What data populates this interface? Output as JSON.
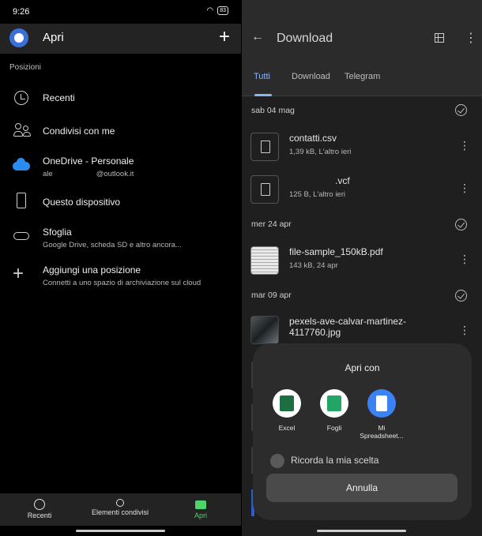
{
  "status_bar": {
    "time": "9:26",
    "battery": "83"
  },
  "left": {
    "app_title": "Apri",
    "section": "Posizioni",
    "items": [
      {
        "label": "Recenti",
        "sub": ""
      },
      {
        "label": "Condivisi con me",
        "sub": ""
      },
      {
        "label": "OneDrive - Personale",
        "sub_a": "ale",
        "sub_b": "@outlook.it"
      },
      {
        "label": "Questo dispositivo",
        "sub": ""
      },
      {
        "label": "Sfoglia",
        "sub": "Google Drive, scheda SD e altro ancora..."
      },
      {
        "label": "Aggiungi una posizione",
        "sub": "Connetti a uno spazio di archiviazione sul cloud"
      }
    ],
    "bottom_nav": [
      {
        "label": "Recenti",
        "active": false
      },
      {
        "label": "Elementi condivisi",
        "active": false
      },
      {
        "label": "Apri",
        "active": true
      }
    ],
    "accent": "#4fd36b"
  },
  "right": {
    "title": "Download",
    "tabs": [
      "Tutti",
      "Download",
      "Telegram"
    ],
    "active_tab": "Tutti",
    "groups": [
      {
        "date": "sab 04 mag",
        "files": [
          {
            "name": "contatti.csv",
            "meta": "1,39 kB, L'altro ieri",
            "thumb": "doc"
          },
          {
            "name": ".vcf",
            "meta": "125 B, L'altro ieri",
            "thumb": "doc"
          }
        ]
      },
      {
        "date": "mer 24 apr",
        "files": [
          {
            "name": "file-sample_150kB.pdf",
            "meta": "143 kB, 24 apr",
            "thumb": "pdf"
          }
        ]
      },
      {
        "date": "mar 09 apr",
        "files": [
          {
            "name": "pexels-ave-calvar-martinez-4117760.jpg",
            "meta": "",
            "thumb": "img"
          }
        ]
      }
    ],
    "accent": "#8ab4f8"
  },
  "dialog": {
    "title": "Apri con",
    "apps": [
      {
        "name": "Excel",
        "color": "#1d6f42"
      },
      {
        "name": "Fogli",
        "color": "#23a566"
      },
      {
        "name": "Mi Spreadsheet...",
        "color": "#3b82f6"
      }
    ],
    "remember": "Ricorda la mia scelta",
    "cancel": "Annulla"
  }
}
